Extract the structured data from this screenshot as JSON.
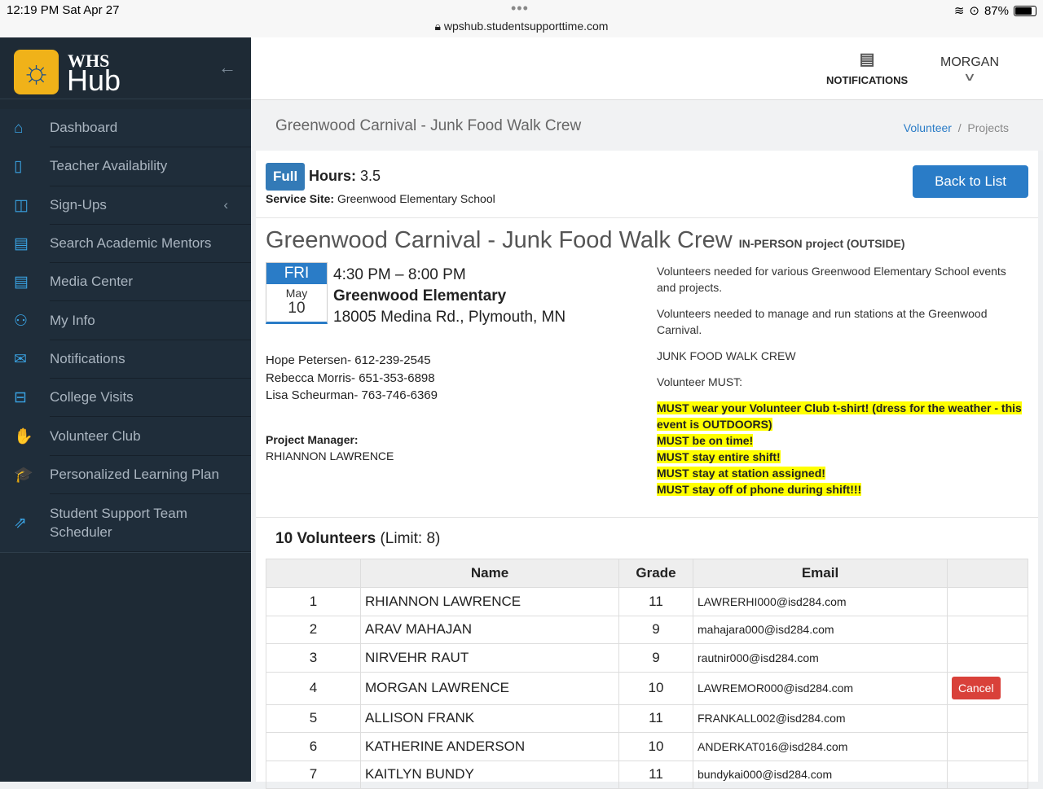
{
  "status": {
    "time": "12:19 PM   Sat Apr 27",
    "url": "wpshub.studentsupporttime.com",
    "battery": "87%"
  },
  "logo": {
    "line1": "WHS",
    "line2": "Hub"
  },
  "sidebar": {
    "items": [
      {
        "label": "Dashboard",
        "icon": "home-icon",
        "glyph": "⌂"
      },
      {
        "label": "Teacher Availability",
        "icon": "document-icon",
        "glyph": "▯"
      },
      {
        "label": "Sign-Ups",
        "icon": "book-icon",
        "glyph": "◫"
      },
      {
        "label": "Search Academic Mentors",
        "icon": "calendar-icon",
        "glyph": "▤"
      },
      {
        "label": "Media Center",
        "icon": "calendar-icon",
        "glyph": "▤"
      },
      {
        "label": "My Info",
        "icon": "user-icon",
        "glyph": "⚇"
      },
      {
        "label": "Notifications",
        "icon": "envelope-icon",
        "glyph": "✉"
      },
      {
        "label": "College Visits",
        "icon": "briefcase-icon",
        "glyph": "⊟"
      },
      {
        "label": "Volunteer Club",
        "icon": "hand-icon",
        "glyph": "✋"
      },
      {
        "label": "Personalized Learning Plan",
        "icon": "graduation-cap-icon",
        "glyph": "🎓"
      },
      {
        "label": "Student Support Team Scheduler",
        "icon": "external-link-icon",
        "glyph": "⇗"
      }
    ]
  },
  "header": {
    "notifications": "NOTIFICATIONS",
    "user": "MORGAN"
  },
  "titlebar": {
    "title": "Greenwood Carnival - Junk Food Walk Crew",
    "breadcrumb": [
      "Volunteer",
      "Projects"
    ]
  },
  "project": {
    "badge": "Full",
    "hours_label": "Hours:",
    "hours": "3.5",
    "site_label": "Service Site:",
    "site": "Greenwood Elementary School",
    "back": "Back to List",
    "title": "Greenwood Carnival - Junk Food Walk Crew",
    "type": "IN-PERSON project (OUTSIDE)",
    "day": "FRI",
    "month": "May",
    "date": "10",
    "time": "4:30 PM – 8:00 PM",
    "location": "Greenwood Elementary",
    "address": "18005 Medina Rd., Plymouth, MN",
    "contacts": [
      "Hope Petersen- 612-239-2545",
      "Rebecca Morris- 651-353-6898",
      "Lisa Scheurman- 763-746-6369"
    ],
    "pm_label": "Project Manager:",
    "pm": "RHIANNON LAWRENCE",
    "desc": [
      "Volunteers needed for various Greenwood Elementary School events and projects.",
      "Volunteers needed to manage and run stations at the Greenwood Carnival.",
      "JUNK FOOD WALK CREW",
      "Volunteer MUST:"
    ],
    "musts": [
      "MUST wear your Volunteer Club t-shirt! (dress for the weather - this event is OUTDOORS)",
      "MUST be on time!",
      "MUST stay entire shift!",
      "MUST stay at station assigned!",
      "MUST stay off of phone during shift!!!"
    ]
  },
  "volunteers": {
    "count": "10 Volunteers",
    "limit": "(Limit: 8)",
    "headers": [
      "",
      "Name",
      "Grade",
      "Email",
      ""
    ],
    "rows": [
      {
        "n": "1",
        "name": "RHIANNON LAWRENCE",
        "grade": "11",
        "email": "LAWRERHI000@isd284.com"
      },
      {
        "n": "2",
        "name": "ARAV MAHAJAN",
        "grade": "9",
        "email": "mahajara000@isd284.com"
      },
      {
        "n": "3",
        "name": "NIRVEHR RAUT",
        "grade": "9",
        "email": "rautnir000@isd284.com"
      },
      {
        "n": "4",
        "name": "MORGAN LAWRENCE",
        "grade": "10",
        "email": "LAWREMOR000@isd284.com",
        "action": "Cancel"
      },
      {
        "n": "5",
        "name": "ALLISON FRANK",
        "grade": "11",
        "email": "FRANKALL002@isd284.com"
      },
      {
        "n": "6",
        "name": "KATHERINE ANDERSON",
        "grade": "10",
        "email": "ANDERKAT016@isd284.com"
      },
      {
        "n": "7",
        "name": "KAITLYN BUNDY",
        "grade": "11",
        "email": "bundykai000@isd284.com"
      }
    ]
  }
}
